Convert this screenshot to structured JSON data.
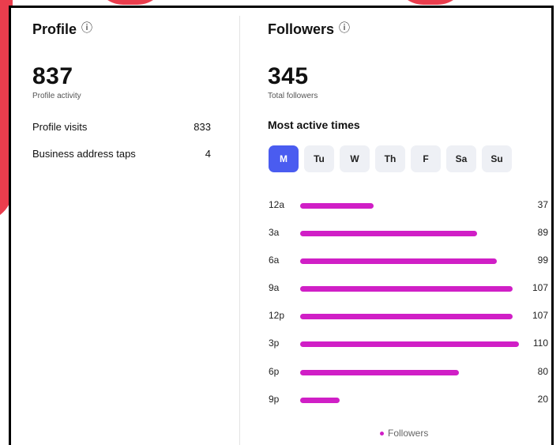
{
  "profile": {
    "title": "Profile",
    "info_icon": "ⓘ",
    "activity_value": "837",
    "activity_label": "Profile activity",
    "stats": [
      {
        "label": "Profile visits",
        "value": "833"
      },
      {
        "label": "Business address taps",
        "value": "4"
      }
    ]
  },
  "followers": {
    "title": "Followers",
    "info_icon": "ⓘ",
    "total_value": "345",
    "total_label": "Total followers",
    "active_title": "Most active times",
    "days": [
      "M",
      "Tu",
      "W",
      "Th",
      "F",
      "Sa",
      "Su"
    ],
    "selected_day": "M",
    "legend": "Followers"
  },
  "colors": {
    "accent": "#4a5cf0",
    "bar": "#d01fc6",
    "background_shape": "#e8283a"
  },
  "chart_data": {
    "type": "bar",
    "orientation": "horizontal",
    "categories": [
      "12a",
      "3a",
      "6a",
      "9a",
      "12p",
      "3p",
      "6p",
      "9p"
    ],
    "series": [
      {
        "name": "Followers",
        "values": [
          37,
          89,
          99,
          107,
          107,
          110,
          80,
          20
        ]
      }
    ],
    "xlim": [
      0,
      110
    ],
    "grid": false,
    "legend": "bottom-center"
  }
}
